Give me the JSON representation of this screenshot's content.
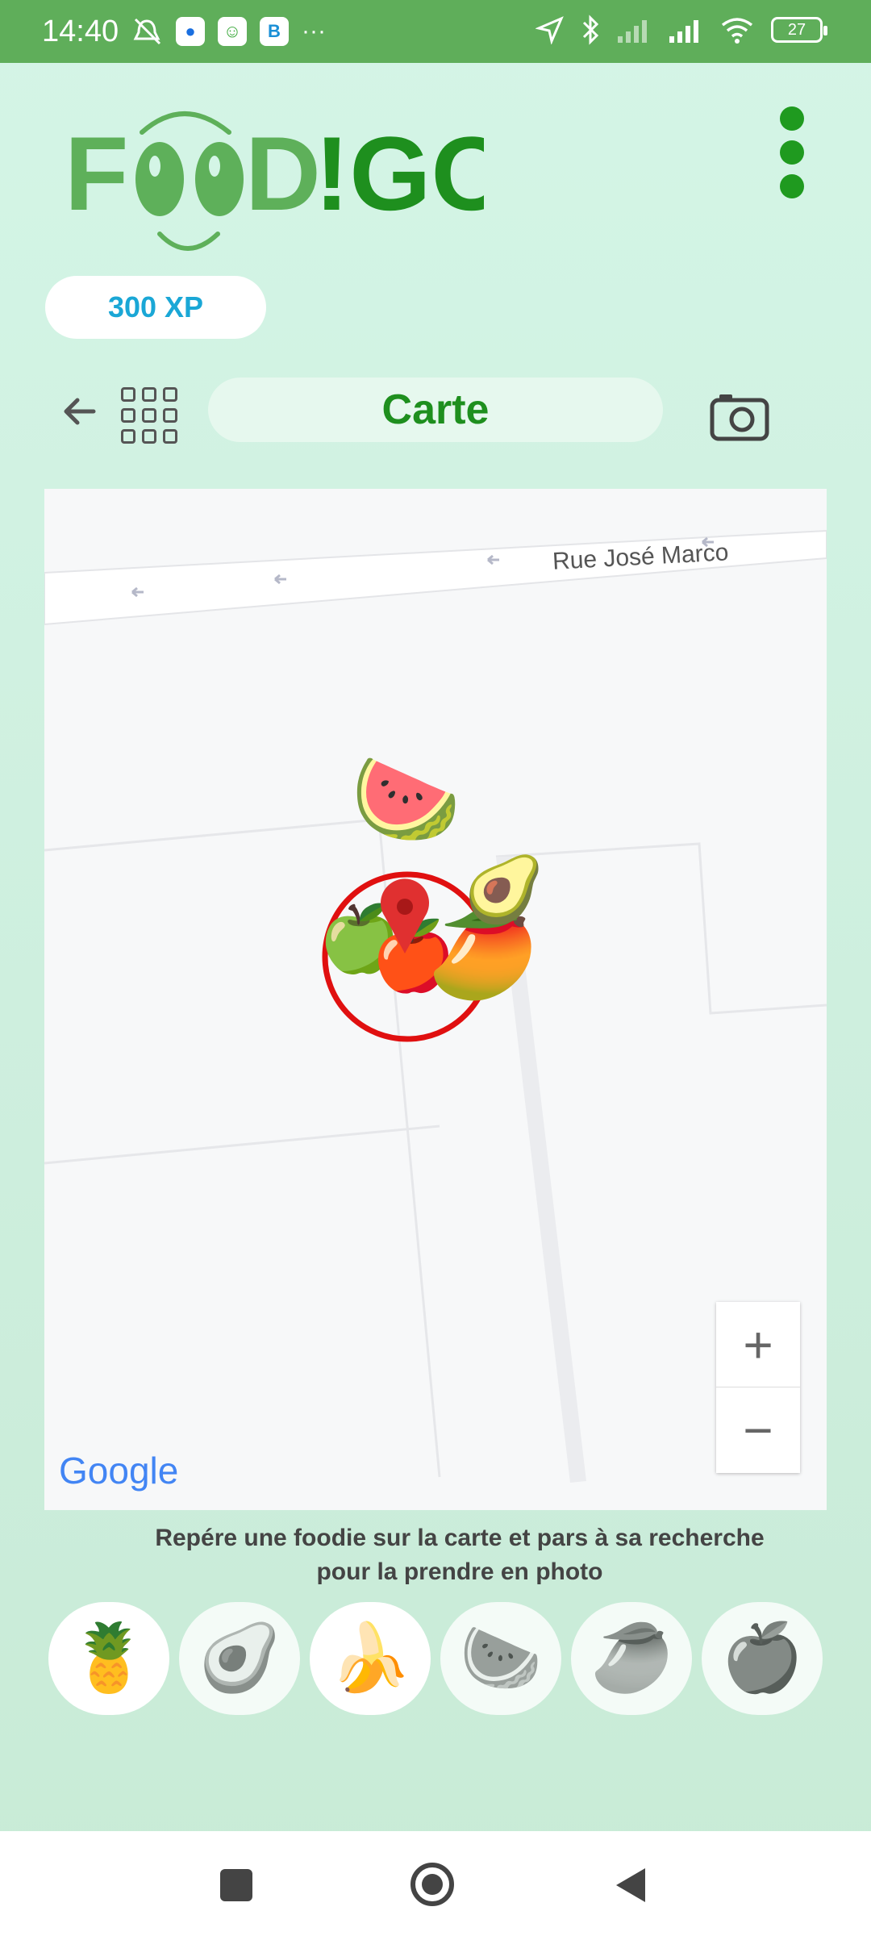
{
  "status_bar": {
    "time": "14:40",
    "battery": "27",
    "more": "···",
    "app_chip_b": "B"
  },
  "header": {
    "brand": "FOOD!GO",
    "xp": "300 XP"
  },
  "toolbar": {
    "title": "Carte"
  },
  "map": {
    "street": "Rue José Marco",
    "provider": "Google",
    "zoom_in": "+",
    "zoom_out": "−"
  },
  "hint": {
    "line1": "Repére une foodie sur la carte et pars à sa recherche",
    "line2": "pour la prendre en photo"
  },
  "foodies": [
    {
      "name": "pineapple",
      "emoji": "🍍",
      "found": true
    },
    {
      "name": "avocado",
      "emoji": "🥑",
      "found": false
    },
    {
      "name": "banana",
      "emoji": "🍌",
      "found": true
    },
    {
      "name": "watermelon",
      "emoji": "🍉",
      "found": false
    },
    {
      "name": "mango",
      "emoji": "🥭",
      "found": false
    },
    {
      "name": "apple",
      "emoji": "🍎",
      "found": false
    }
  ],
  "colors": {
    "status_bar": "#5fae5a",
    "brand_green": "#1e8f1e",
    "brand_light": "#5eb05a",
    "xp_blue": "#1aa7d6",
    "circle_red": "#e01010"
  }
}
